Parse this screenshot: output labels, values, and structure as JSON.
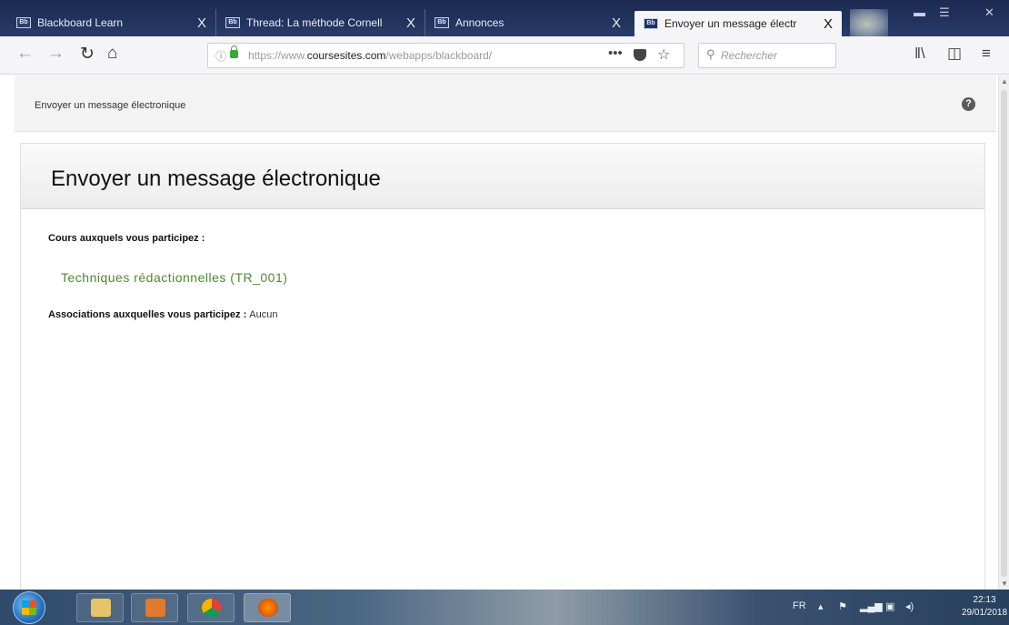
{
  "browser": {
    "tabs": [
      {
        "favicon": "Bb",
        "title": "Blackboard Learn",
        "close": "X",
        "active": false
      },
      {
        "favicon": "Bb",
        "title": "Thread: La méthode Cornell",
        "close": "X",
        "active": false
      },
      {
        "favicon": "Bb",
        "title": "Annonces",
        "close": "X",
        "active": false
      },
      {
        "favicon": "Bb",
        "title": "Envoyer un message électr",
        "close": "X",
        "active": true
      }
    ],
    "url": {
      "prefix": "https://www.",
      "domain": "coursesites.com",
      "path": "/webapps/blackboard/"
    },
    "search_placeholder": "Rechercher",
    "icons": {
      "back": "back-arrow-icon",
      "forward": "forward-arrow-icon",
      "reload": "reload-icon",
      "home": "home-icon",
      "more": "page-actions-icon",
      "pocket": "pocket-icon",
      "bookmark": "star-icon",
      "library": "library-icon",
      "sidebar": "sidebar-icon",
      "menu": "hamburger-menu-icon"
    }
  },
  "page": {
    "breadcrumb": "Envoyer un message électronique",
    "help_icon": "?",
    "title": "Envoyer un message électronique",
    "courses_label": "Cours auxquels vous participez :",
    "course_link": "Techniques rédactionnelles (TR_001)",
    "associations_label": "Associations auxquelles vous participez :",
    "associations_value": "Aucun"
  },
  "taskbar": {
    "language": "FR",
    "time": "22:13",
    "date": "29/01/2018"
  },
  "colors": {
    "tab_strip": "#1d2b52",
    "link_green": "#4b8a2f",
    "panel_header": "#ececec"
  }
}
